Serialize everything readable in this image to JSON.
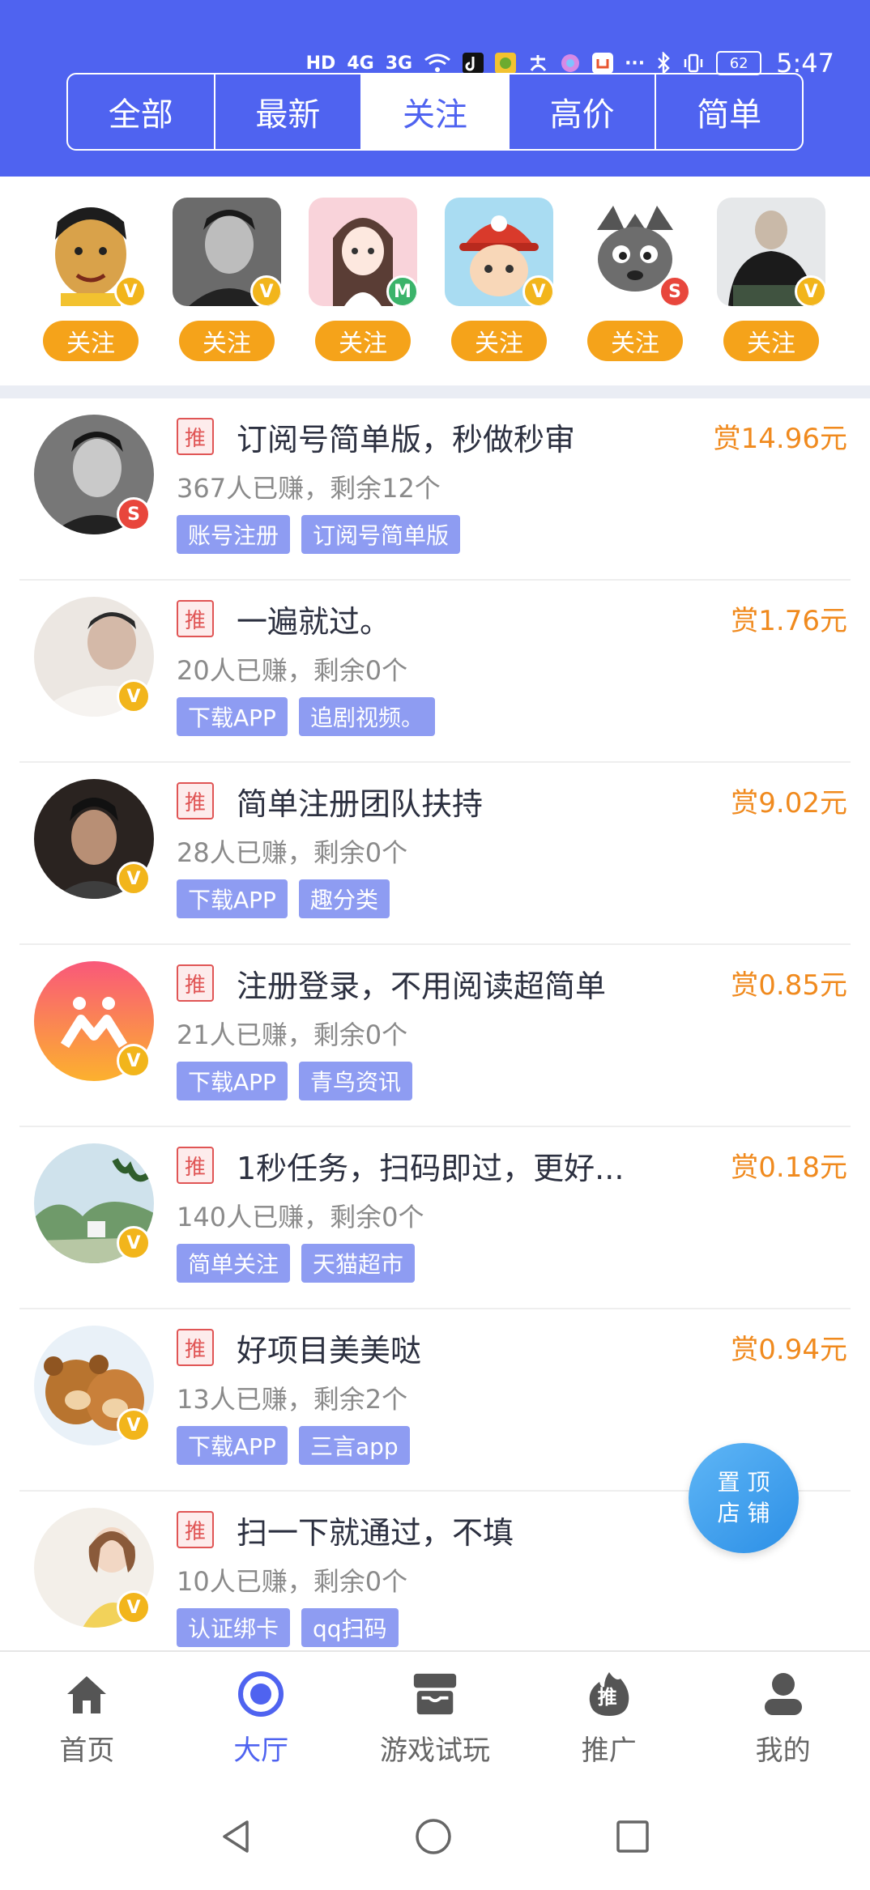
{
  "status_bar": {
    "network_1": "4G",
    "network_2": "3G",
    "battery": "62",
    "time": "5:47",
    "more": "···"
  },
  "tabs": [
    {
      "label": "全部"
    },
    {
      "label": "最新"
    },
    {
      "label": "关注",
      "active": true
    },
    {
      "label": "高价"
    },
    {
      "label": "简单"
    }
  ],
  "followed": [
    {
      "badge": "V",
      "follow_label": "关注",
      "avatar_color": "#d9a24a"
    },
    {
      "badge": "V",
      "follow_label": "关注",
      "avatar_color": "#555555"
    },
    {
      "badge": "M",
      "follow_label": "关注",
      "avatar_color": "#f7c8cf"
    },
    {
      "badge": "V",
      "follow_label": "关注",
      "avatar_color": "#7fc5e6"
    },
    {
      "badge": "S",
      "follow_label": "关注",
      "avatar_color": "#6d6d6d"
    },
    {
      "badge": "V",
      "follow_label": "关注",
      "avatar_color": "#9aa0a6"
    }
  ],
  "tasks": [
    {
      "tag": "推",
      "title": "订阅号简单版，秒做秒审",
      "reward": "赏14.96元",
      "stats": "367人已赚，剩余12个",
      "chips": [
        "账号注册",
        "订阅号简单版"
      ],
      "badge": "S",
      "avatar_color": "#3a3a3a"
    },
    {
      "tag": "推",
      "title": "一遍就过。",
      "reward": "赏1.76元",
      "stats": "20人已赚，剩余0个",
      "chips": [
        "下载APP",
        "追剧视频。"
      ],
      "badge": "V",
      "avatar_color": "#d8d2cc"
    },
    {
      "tag": "推",
      "title": "简单注册团队扶持",
      "reward": "赏9.02元",
      "stats": "28人已赚，剩余0个",
      "chips": [
        "下载APP",
        "趣分类"
      ],
      "badge": "V",
      "avatar_color": "#4a3b34"
    },
    {
      "tag": "推",
      "title": "注册登录，不用阅读超简单",
      "reward": "赏0.85元",
      "stats": "21人已赚，剩余0个",
      "chips": [
        "下载APP",
        "青鸟资讯"
      ],
      "badge": "V",
      "avatar_color": "#f76a6a"
    },
    {
      "tag": "推",
      "title": "1秒任务，扫码即过，更好...",
      "reward": "赏0.18元",
      "stats": "140人已赚，剩余0个",
      "chips": [
        "简单关注",
        "天猫超市"
      ],
      "badge": "V",
      "avatar_color": "#8fb7a0"
    },
    {
      "tag": "推",
      "title": "好项目美美哒",
      "reward": "赏0.94元",
      "stats": "13人已赚，剩余2个",
      "chips": [
        "下载APP",
        "三言app"
      ],
      "badge": "V",
      "avatar_color": "#c07a3a"
    },
    {
      "tag": "推",
      "title": "扫一下就通过，不填",
      "reward": "",
      "stats": "10人已赚，剩余0个",
      "chips": [
        "认证绑卡",
        "qq扫码"
      ],
      "badge": "V",
      "avatar_color": "#e8ded0"
    }
  ],
  "fab": {
    "line1": "置 顶",
    "line2": "店 铺"
  },
  "bottom_nav": [
    {
      "label": "首页",
      "icon": "home-icon"
    },
    {
      "label": "大厅",
      "icon": "hall-icon",
      "active": true
    },
    {
      "label": "游戏试玩",
      "icon": "game-box-icon"
    },
    {
      "label": "推广",
      "icon": "promote-icon",
      "icon_text": "推"
    },
    {
      "label": "我的",
      "icon": "profile-icon"
    }
  ],
  "colors": {
    "primary": "#4f63f0",
    "follow_button": "#f5a31a",
    "reward": "#f08a1e",
    "chip": "#8e9cf2",
    "tag_red": "#e05555"
  }
}
